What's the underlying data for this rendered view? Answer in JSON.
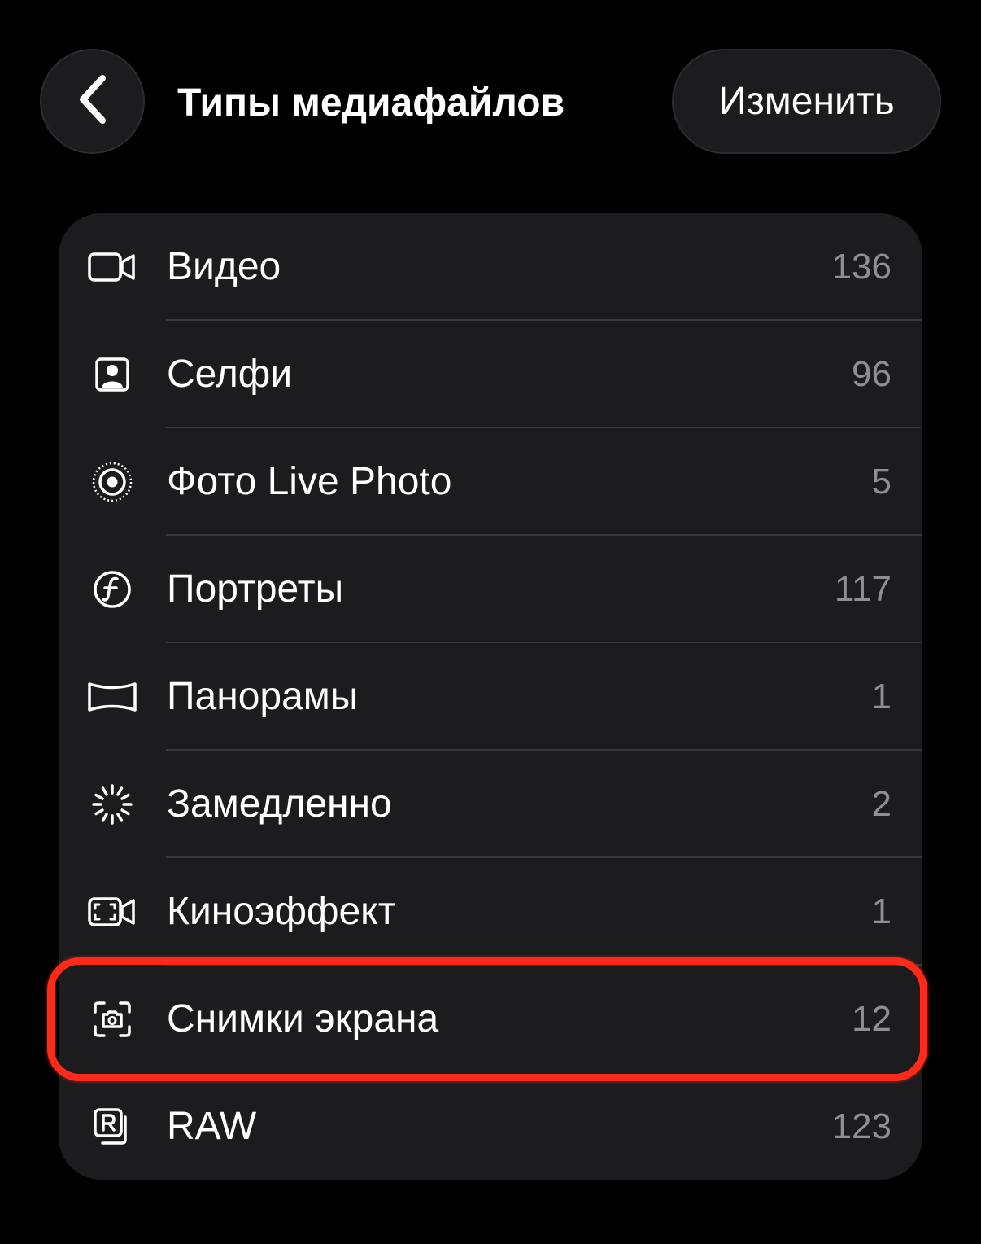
{
  "header": {
    "title": "Типы медиафайлов",
    "back_icon": "chevron-left-icon",
    "edit_label": "Изменить"
  },
  "items": [
    {
      "label": "Видео",
      "count": "136",
      "icon": "video-camera-icon"
    },
    {
      "label": "Селфи",
      "count": "96",
      "icon": "selfie-portrait-icon"
    },
    {
      "label": "Фото Live Photo",
      "count": "5",
      "icon": "live-photo-icon"
    },
    {
      "label": "Портреты",
      "count": "117",
      "icon": "portrait-aperture-icon"
    },
    {
      "label": "Панорамы",
      "count": "1",
      "icon": "panorama-icon"
    },
    {
      "label": "Замедленно",
      "count": "2",
      "icon": "slow-motion-icon"
    },
    {
      "label": "Киноэффект",
      "count": "1",
      "icon": "cinematic-icon"
    },
    {
      "label": "Снимки экрана",
      "count": "12",
      "icon": "screenshot-icon"
    },
    {
      "label": "RAW",
      "count": "123",
      "icon": "raw-icon"
    }
  ],
  "highlight": {
    "target_item": "Снимки экрана",
    "color": "#ff2a1a"
  },
  "colors": {
    "background": "#000000",
    "card": "#1c1c1e",
    "label": "#ffffff",
    "count": "#8e8e93",
    "divider": "#38383a"
  }
}
